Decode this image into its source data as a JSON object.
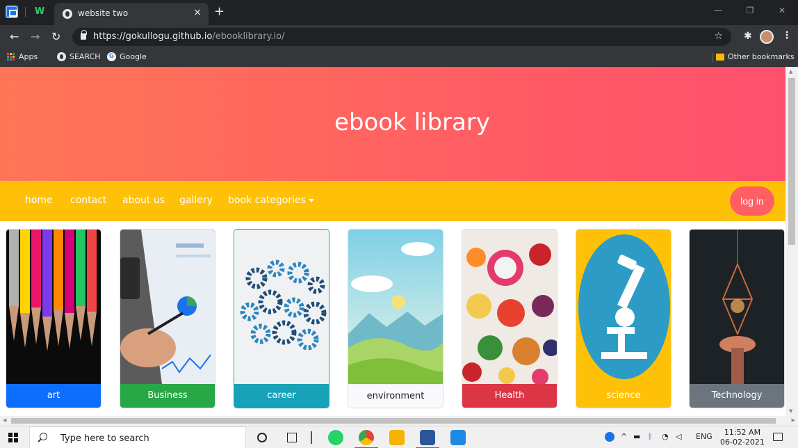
{
  "browser": {
    "tab_title": "website two",
    "tab_close": "×",
    "new_tab": "+",
    "url_host": "https://gokullogu.github.io",
    "url_path": "/ebooklibrary.io/",
    "bookmarks": {
      "apps": "Apps",
      "search": "SEARCH",
      "google": "Google",
      "other": "Other bookmarks"
    }
  },
  "page": {
    "hero_title": "ebook library",
    "nav": {
      "home": "home",
      "contact": "contact",
      "about": "about us",
      "gallery": "gallery",
      "categories": "book categories"
    },
    "login_label": "log in",
    "categories": [
      {
        "label": "art",
        "color": "#0d6efd"
      },
      {
        "label": "Business",
        "color": "#28a745"
      },
      {
        "label": "career",
        "color": "#17a2b8"
      },
      {
        "label": "environment",
        "color": "#f8f9fa"
      },
      {
        "label": "Health",
        "color": "#dc3545"
      },
      {
        "label": "science",
        "color": "#ffc107"
      },
      {
        "label": "Technology",
        "color": "#6c757d"
      }
    ]
  },
  "taskbar": {
    "search_placeholder": "Type here to search",
    "language": "ENG",
    "time": "11:52 AM",
    "date": "06-02-2021"
  },
  "colors": {
    "hero": "#ff5e62",
    "navbar": "#ffc107",
    "login": "#ff5e62"
  }
}
